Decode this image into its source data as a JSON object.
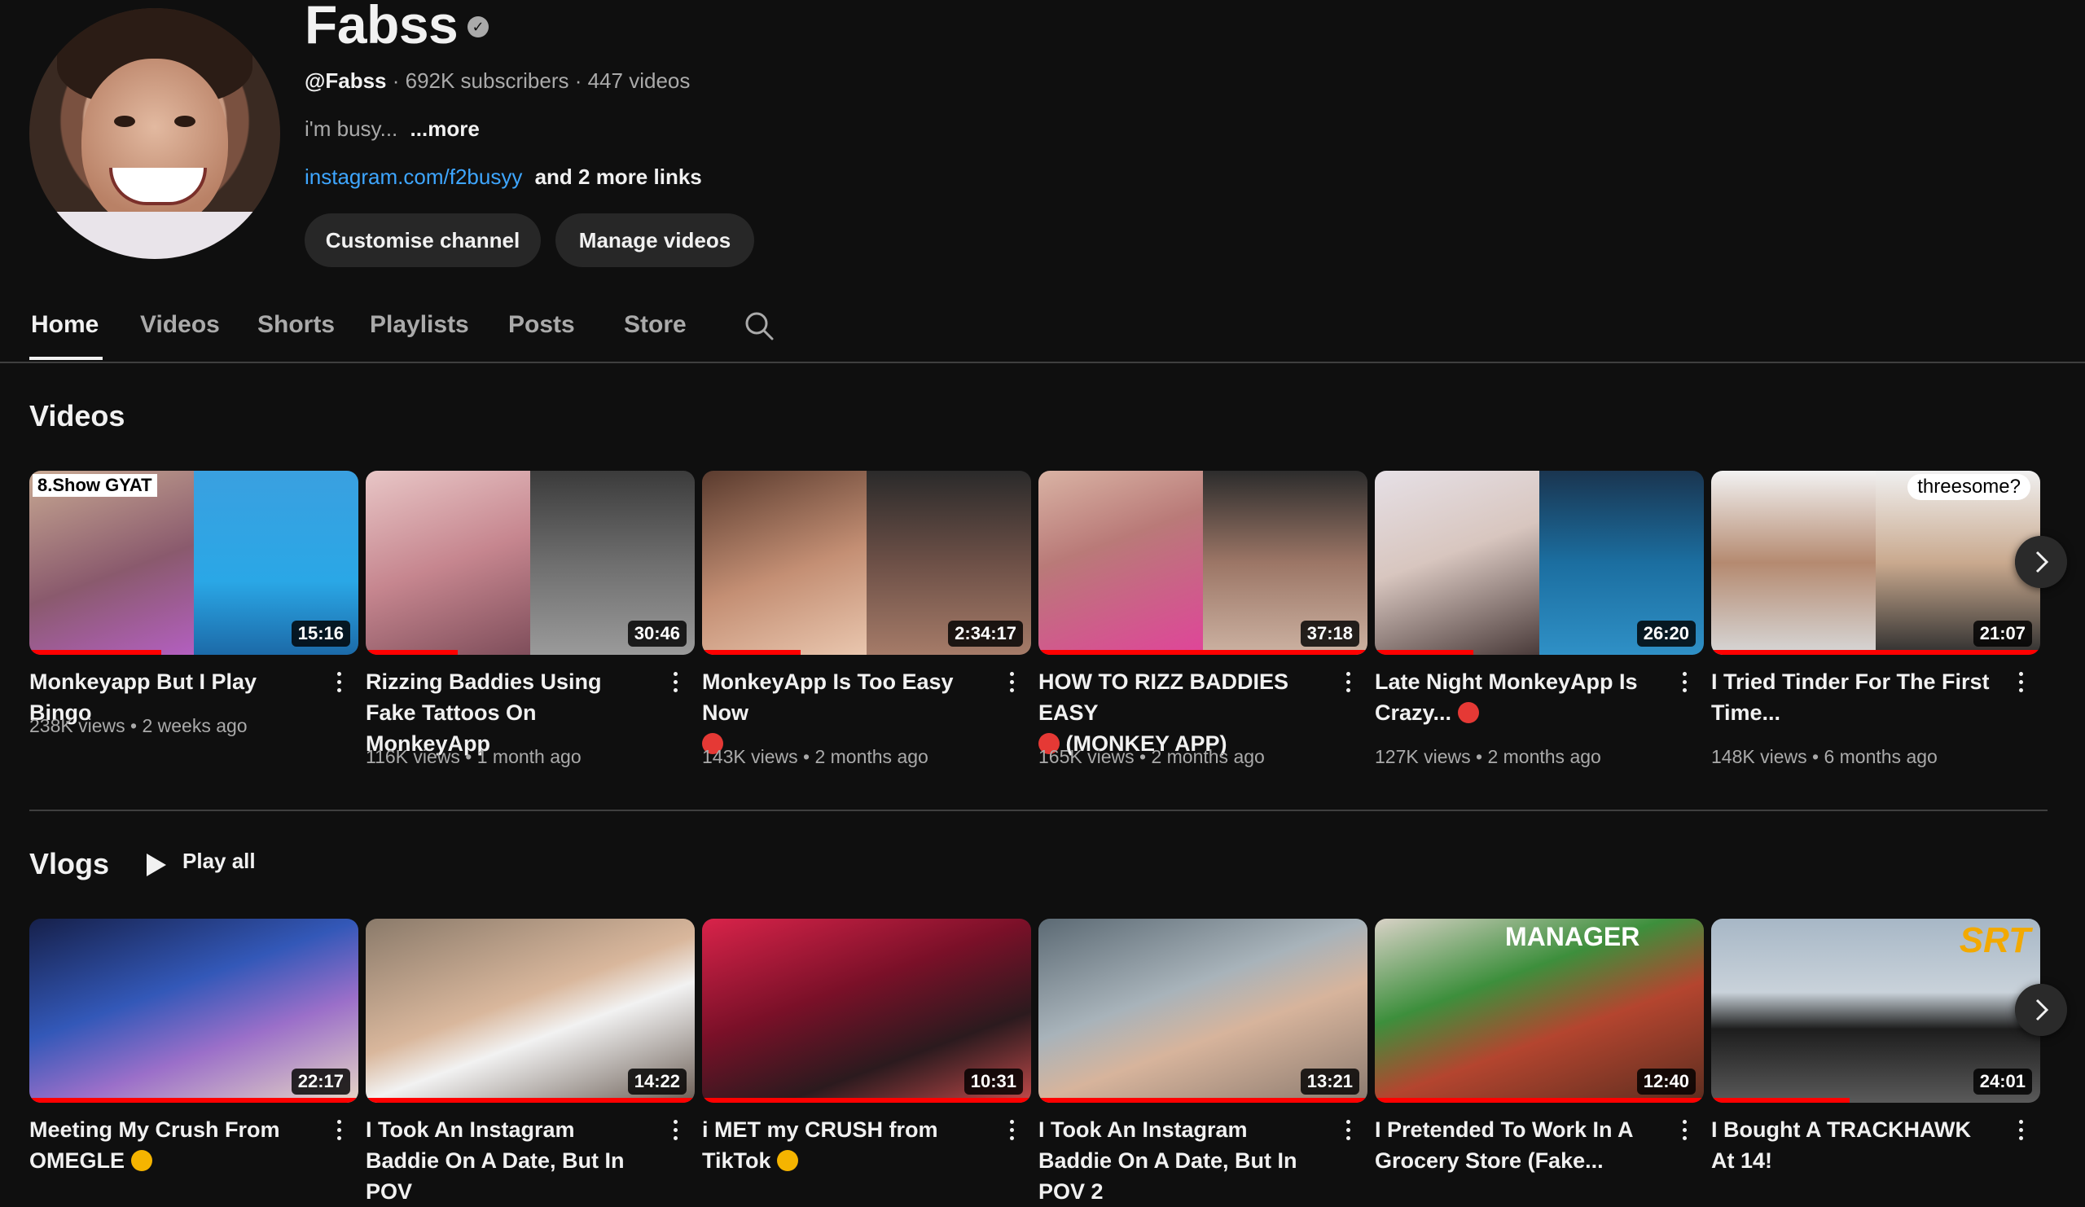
{
  "channel": {
    "name": "Fabss",
    "handle": "@Fabss",
    "stats": "· 692K subscribers · 447 videos",
    "description": "i'm busy...",
    "more": "...more",
    "link": "instagram.com/f2busyy",
    "more_links": "and 2 more links",
    "customise_label": "Customise channel",
    "manage_label": "Manage videos"
  },
  "tabs": [
    "Home",
    "Videos",
    "Shorts",
    "Playlists",
    "Posts",
    "Store"
  ],
  "sections": {
    "videos_title": "Videos",
    "vlogs_title": "Vlogs",
    "play_all": "Play all"
  },
  "videos": [
    {
      "title": "Monkeyapp But I Play Bingo",
      "stats": "238K views • 2 weeks ago",
      "duration": "15:16"
    },
    {
      "title": "Rizzing Baddies Using Fake Tattoos On MonkeyApp",
      "stats": "116K views • 1 month ago",
      "duration": "30:46"
    },
    {
      "title": "MonkeyApp Is Too Easy Now",
      "stats": "143K views • 2 months ago",
      "duration": "2:34:17"
    },
    {
      "title": "HOW TO RIZZ BADDIES EASY",
      "title2": "(MONKEY APP)",
      "stats": "165K views • 2 months ago",
      "duration": "37:18"
    },
    {
      "title": "Late Night MonkeyApp Is Crazy...",
      "stats": "127K views • 2 months ago",
      "duration": "26:20"
    },
    {
      "title": "I Tried Tinder For The First Time...",
      "stats": "148K views • 6 months ago",
      "duration": "21:07"
    }
  ],
  "vlogs": [
    {
      "title": "Meeting My Crush From OMEGLE",
      "duration": "22:17"
    },
    {
      "title": "I Took An Instagram Baddie On A Date, But In POV",
      "duration": "14:22"
    },
    {
      "title": "i MET my CRUSH from TikTok",
      "duration": "10:31"
    },
    {
      "title": "I Took An Instagram Baddie On A Date, But In POV 2",
      "duration": "13:21"
    },
    {
      "title": "I Pretended To Work In A Grocery Store (Fake...",
      "duration": "12:40"
    },
    {
      "title": "I Bought A TRACKHAWK At 14!",
      "duration": "24:01"
    }
  ],
  "thumb_text": {
    "v0": "8.Show GYAT",
    "v5": "threesome?",
    "g4": "MANAGER",
    "g5": "SRT"
  },
  "colors": {
    "background": "#0f0f0f",
    "text": "#f1f1f1",
    "secondary": "#aaaaaa",
    "link": "#3ea6ff",
    "button": "#272727",
    "progress": "#ff0000"
  }
}
